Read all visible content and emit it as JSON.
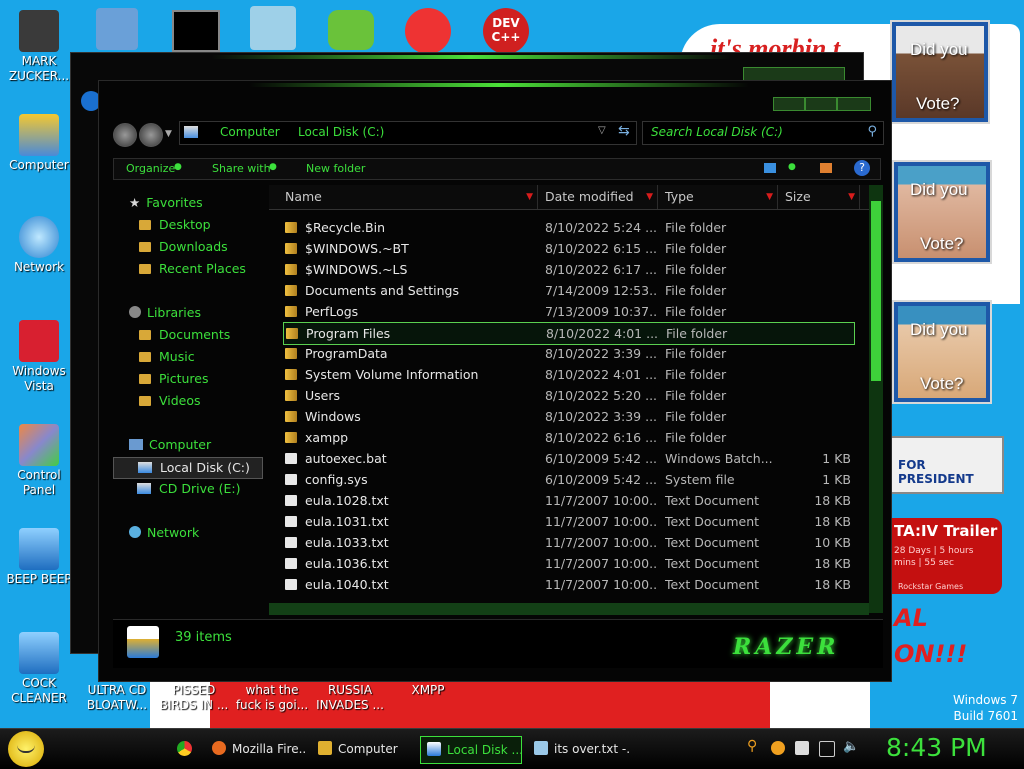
{
  "desktop": {
    "icons_left": [
      {
        "label": "MARK ZUCKER...",
        "icon": "person-icon"
      },
      {
        "label": "Computer",
        "icon": "computer-icon"
      },
      {
        "label": "Network",
        "icon": "network-icon"
      },
      {
        "label": "Windows Vista",
        "icon": "recycle-bin-icon"
      },
      {
        "label": "Control Panel",
        "icon": "control-panel-icon"
      },
      {
        "label": "BEEP BEEP",
        "icon": "file-icon"
      },
      {
        "label": "COCK CLEANER",
        "icon": "file-icon"
      }
    ],
    "icons_bottom": [
      {
        "label": "ULTRA CD BLOATW..."
      },
      {
        "label": "PISSED BIRDS IN ..."
      },
      {
        "label": "what the fuck is goi..."
      },
      {
        "label": "RUSSIA INVADES ..."
      },
      {
        "label": "XMPP"
      }
    ],
    "top_icon_labels": [
      "DEV C++"
    ],
    "wallpaper_texts": {
      "banner": "it's morbin t",
      "poster_text_1": "Did you",
      "poster_text_2": "Vote?",
      "for_president": "FOR PRESIDENT",
      "trailer": "TA:IV Trailer",
      "trailer_sub1": "28 Days | 5 hours",
      "trailer_sub2": "mins | 55 sec",
      "trailer_footer": "Rockstar Games",
      "red_text_1": "AL",
      "red_text_2": "ON!!!"
    },
    "watermark": {
      "line1": "Windows 7",
      "line2": "Build 7601"
    }
  },
  "explorer": {
    "breadcrumb": [
      "Computer",
      "Local Disk (C:)"
    ],
    "search_placeholder": "Search Local Disk (C:)",
    "toolbar": {
      "organize": "Organize",
      "share_with": "Share with",
      "new_folder": "New folder"
    },
    "nav": {
      "favorites": "Favorites",
      "favorites_items": [
        "Desktop",
        "Downloads",
        "Recent Places"
      ],
      "libraries": "Libraries",
      "libraries_items": [
        "Documents",
        "Music",
        "Pictures",
        "Videos"
      ],
      "computer": "Computer",
      "computer_items": [
        "Local Disk (C:)",
        "CD Drive (E:)"
      ],
      "network": "Network"
    },
    "columns": {
      "name": "Name",
      "date": "Date modified",
      "type": "Type",
      "size": "Size"
    },
    "files": [
      {
        "name": "$Recycle.Bin",
        "date": "8/10/2022 5:24 ...",
        "type": "File folder",
        "size": ""
      },
      {
        "name": "$WINDOWS.~BT",
        "date": "8/10/2022 6:15 ...",
        "type": "File folder",
        "size": ""
      },
      {
        "name": "$WINDOWS.~LS",
        "date": "8/10/2022 6:17 ...",
        "type": "File folder",
        "size": ""
      },
      {
        "name": "Documents and Settings",
        "date": "7/14/2009 12:53...",
        "type": "File folder",
        "size": ""
      },
      {
        "name": "PerfLogs",
        "date": "7/13/2009 10:37...",
        "type": "File folder",
        "size": ""
      },
      {
        "name": "Program Files",
        "date": "8/10/2022 4:01 ...",
        "type": "File folder",
        "size": ""
      },
      {
        "name": "ProgramData",
        "date": "8/10/2022 3:39 ...",
        "type": "File folder",
        "size": ""
      },
      {
        "name": "System Volume Information",
        "date": "8/10/2022 4:01 ...",
        "type": "File folder",
        "size": ""
      },
      {
        "name": "Users",
        "date": "8/10/2022 5:20 ...",
        "type": "File folder",
        "size": ""
      },
      {
        "name": "Windows",
        "date": "8/10/2022 3:39 ...",
        "type": "File folder",
        "size": ""
      },
      {
        "name": "xampp",
        "date": "8/10/2022 6:16 ...",
        "type": "File folder",
        "size": ""
      },
      {
        "name": "autoexec.bat",
        "date": "6/10/2009 5:42 ...",
        "type": "Windows Batch...",
        "size": "1 KB"
      },
      {
        "name": "config.sys",
        "date": "6/10/2009 5:42 ...",
        "type": "System file",
        "size": "1 KB"
      },
      {
        "name": "eula.1028.txt",
        "date": "11/7/2007 10:00...",
        "type": "Text Document",
        "size": "18 KB"
      },
      {
        "name": "eula.1031.txt",
        "date": "11/7/2007 10:00...",
        "type": "Text Document",
        "size": "18 KB"
      },
      {
        "name": "eula.1033.txt",
        "date": "11/7/2007 10:00...",
        "type": "Text Document",
        "size": "10 KB"
      },
      {
        "name": "eula.1036.txt",
        "date": "11/7/2007 10:00...",
        "type": "Text Document",
        "size": "18 KB"
      },
      {
        "name": "eula.1040.txt",
        "date": "11/7/2007 10:00...",
        "type": "Text Document",
        "size": "18 KB"
      }
    ],
    "selected_item": "Program Files",
    "status": "39 items",
    "brand": "Razer"
  },
  "taskbar": {
    "items": [
      {
        "label": "Mozilla Fire...",
        "icon": "firefox-icon"
      },
      {
        "label": "Computer",
        "icon": "explorer-icon"
      },
      {
        "label": "Local Disk ...",
        "icon": "drive-icon"
      },
      {
        "label": "its over.txt -...",
        "icon": "notepad-icon"
      }
    ],
    "clock": "8:43 PM"
  },
  "colors": {
    "accent": "#3ce03c",
    "desktop": "#1aa6e8",
    "window": "#050505",
    "arrow": "#d81c1c"
  }
}
